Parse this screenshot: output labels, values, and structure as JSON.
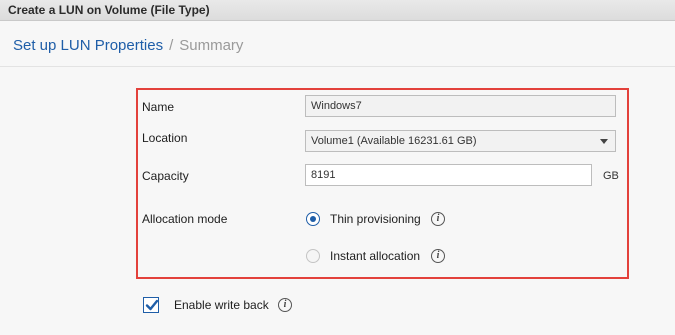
{
  "window": {
    "title": "Create a LUN on Volume (File Type)"
  },
  "breadcrumb": {
    "current": "Set up LUN Properties",
    "separator": "/",
    "next": "Summary"
  },
  "form": {
    "name": {
      "label": "Name",
      "value": "Windows7"
    },
    "location": {
      "label": "Location",
      "value": "Volume1 (Available 16231.61 GB)"
    },
    "capacity": {
      "label": "Capacity",
      "value": "8191",
      "unit": "GB"
    },
    "allocation": {
      "label": "Allocation mode",
      "options": [
        {
          "label": "Thin provisioning",
          "selected": true
        },
        {
          "label": "Instant allocation",
          "selected": false
        }
      ]
    }
  },
  "write_back": {
    "label": "Enable write back",
    "checked": true
  },
  "colors": {
    "accent": "#1f5ea8",
    "highlight": "#e3413b"
  }
}
